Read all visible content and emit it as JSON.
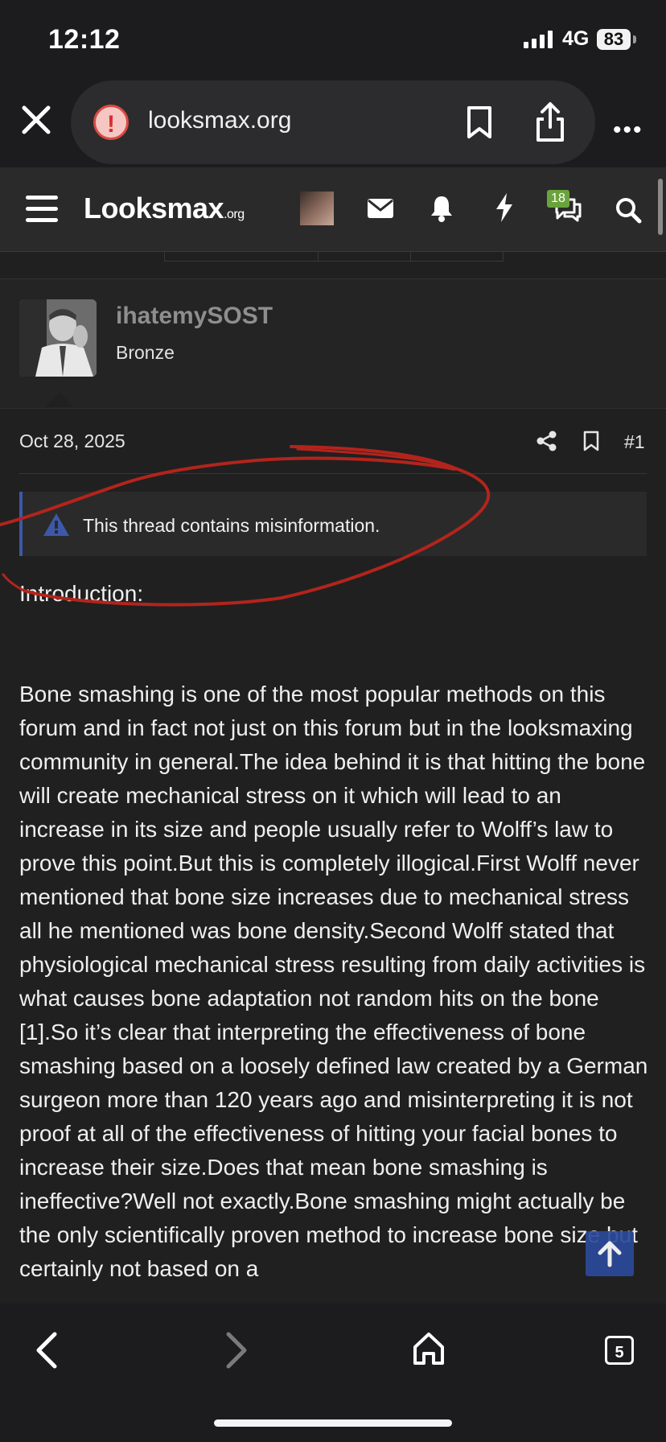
{
  "status_bar": {
    "time": "12:12",
    "network": "4G",
    "battery": "83"
  },
  "browser": {
    "url": "looksmax.org"
  },
  "site": {
    "logo_main": "Looksmax",
    "logo_suffix": ".org",
    "alerts_badge": "18"
  },
  "post": {
    "username": "ihatemySOST",
    "rank": "Bronze",
    "date": "Oct 28, 2025",
    "number": "#1",
    "notice": "This thread contains misinformation.",
    "intro": "Introduction:",
    "body": "Bone smashing is one of the most popular methods on this forum and in fact not just on this forum but in the looksmaxing community in general.The idea behind it is that hitting the bone will create mechanical stress on it which will lead to an increase in its size and people usually refer to Wolff’s law to prove this point.But this is completely illogical.First Wolff never mentioned that bone size increases due to mechanical stress all he mentioned was bone density.Second Wolff stated that physiological mechanical stress resulting from daily activities is what causes bone adaptation not random hits on the bone [1].So it’s clear that interpreting the effectiveness of bone smashing based on a loosely defined law created by a German surgeon more than 120 years ago and misinterpreting it is not proof at all of the effectiveness of hitting your facial bones to increase their size.Does that mean bone smashing is ineffective?Well not exactly.Bone smashing might actually be the only scientifically proven method to increase bone size but certainly not based on a"
  },
  "bottom_nav": {
    "tabs_count": "5"
  },
  "colors": {
    "background": "#202020",
    "header": "#2a2a2a",
    "notice_accent": "#3d58a8",
    "annotation": "#b3241c",
    "badge": "#6aa33b"
  },
  "icons": [
    "close-icon",
    "warning-icon",
    "bookmark-icon",
    "share-icon",
    "more-icon",
    "menu-icon",
    "mail-icon",
    "bell-icon",
    "bolt-icon",
    "chat-icon",
    "search-icon",
    "arrow-up-icon",
    "back-icon",
    "forward-icon",
    "home-icon",
    "tabs-icon"
  ]
}
